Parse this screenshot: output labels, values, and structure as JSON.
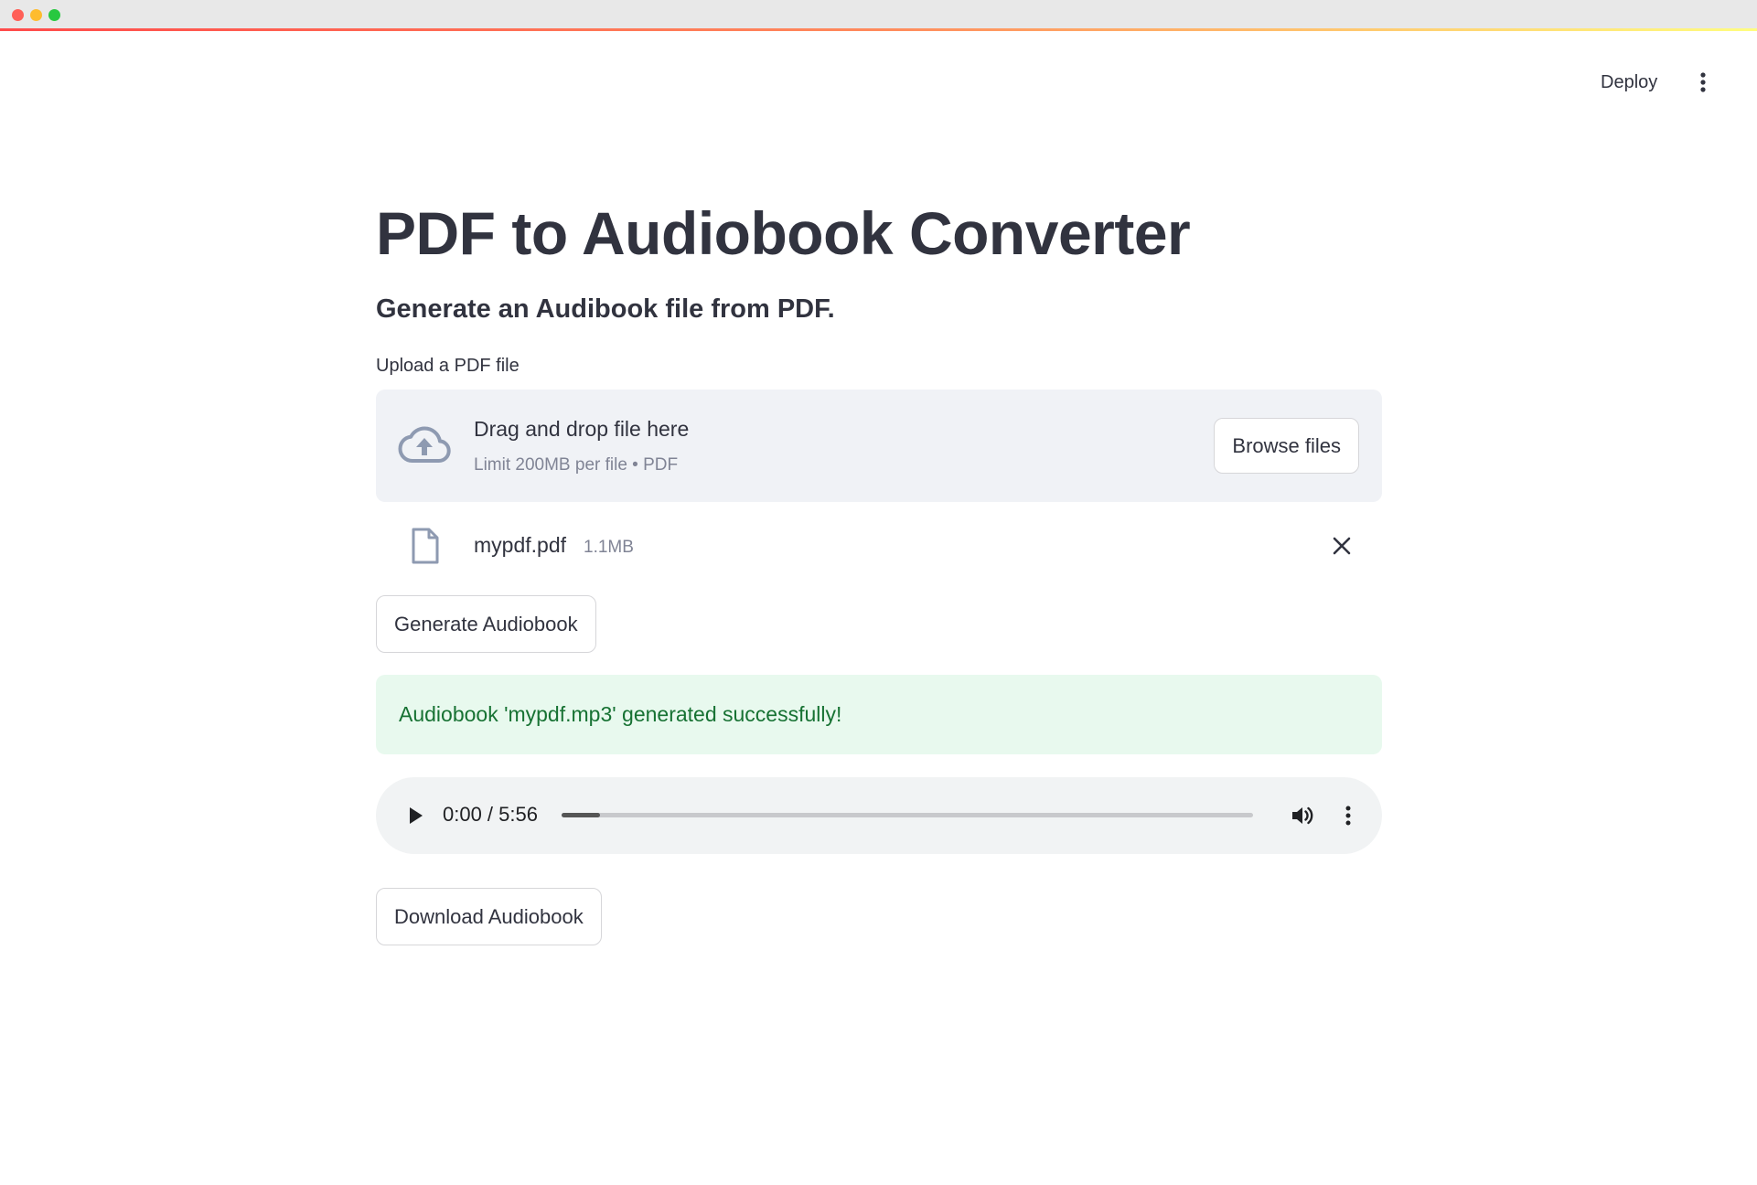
{
  "header": {
    "deploy_label": "Deploy"
  },
  "main": {
    "title": "PDF to Audiobook Converter",
    "subtitle": "Generate an Audibook file from PDF.",
    "uploader": {
      "label": "Upload a PDF file",
      "drop_title": "Drag and drop file here",
      "drop_limit": "Limit 200MB per file • PDF",
      "browse_label": "Browse files"
    },
    "file": {
      "name": "mypdf.pdf",
      "size": "1.1MB"
    },
    "generate_label": "Generate Audiobook",
    "success_message": "Audiobook 'mypdf.mp3' generated successfully!",
    "audio": {
      "time": "0:00 / 5:56",
      "progress_fraction": 0.055
    },
    "download_label": "Download Audiobook"
  },
  "colors": {
    "accent": "#ff4b4b",
    "text": "#31333f",
    "success_bg": "#e8f9ee",
    "success_text": "#177233"
  },
  "icons": {
    "upload": "cloud-upload-icon",
    "file": "file-icon",
    "remove": "close-icon",
    "play": "play-icon",
    "volume": "volume-icon",
    "more": "more-vertical-icon"
  }
}
